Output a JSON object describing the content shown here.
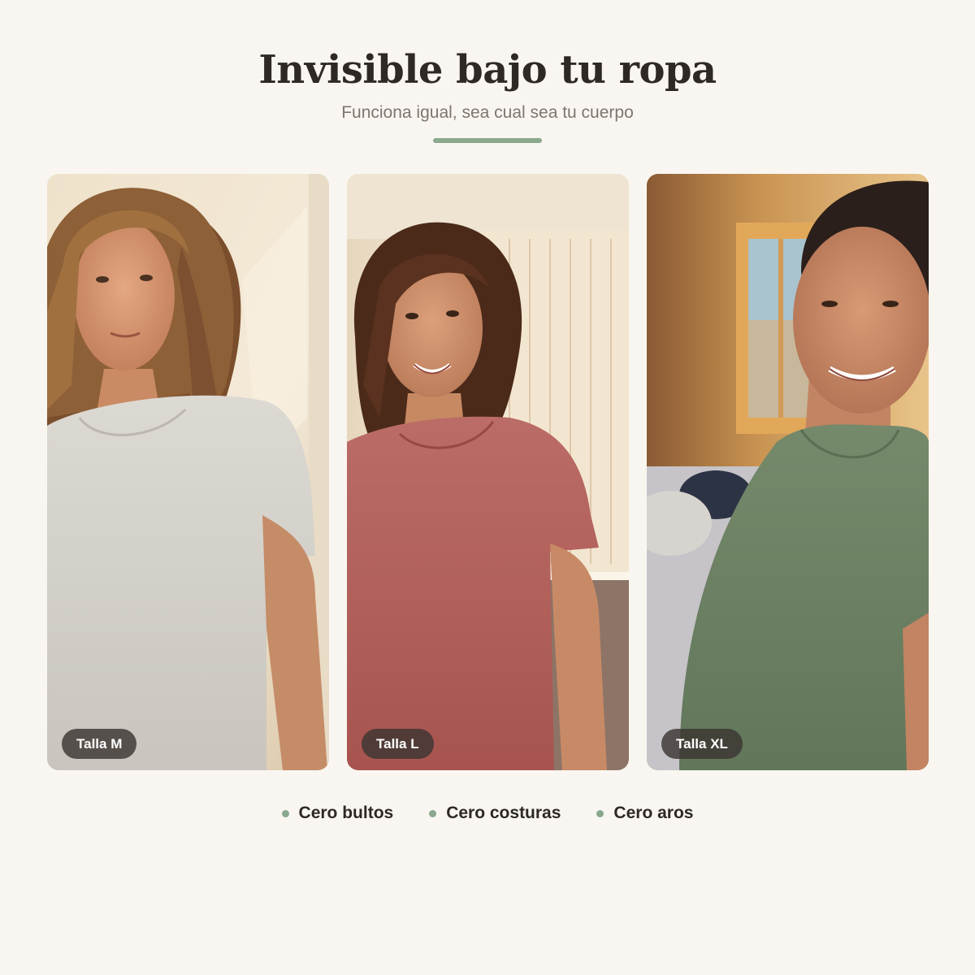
{
  "section": {
    "title": "Invisible bajo tu ropa",
    "subtitle": "Funciona igual, sea cual sea tu cuerpo",
    "accent_color": "#8aa88d"
  },
  "cards": [
    {
      "size_label": "Talla M",
      "shirt_color": "#d8d5cf",
      "photo": "woman-in-light-grey-tshirt"
    },
    {
      "size_label": "Talla L",
      "shirt_color": "#b56863",
      "photo": "woman-in-rose-tshirt"
    },
    {
      "size_label": "Talla XL",
      "shirt_color": "#6f8466",
      "photo": "woman-in-sage-green-tshirt"
    }
  ],
  "features": [
    {
      "label": "Cero bultos"
    },
    {
      "label": "Cero costuras"
    },
    {
      "label": "Cero aros"
    }
  ]
}
